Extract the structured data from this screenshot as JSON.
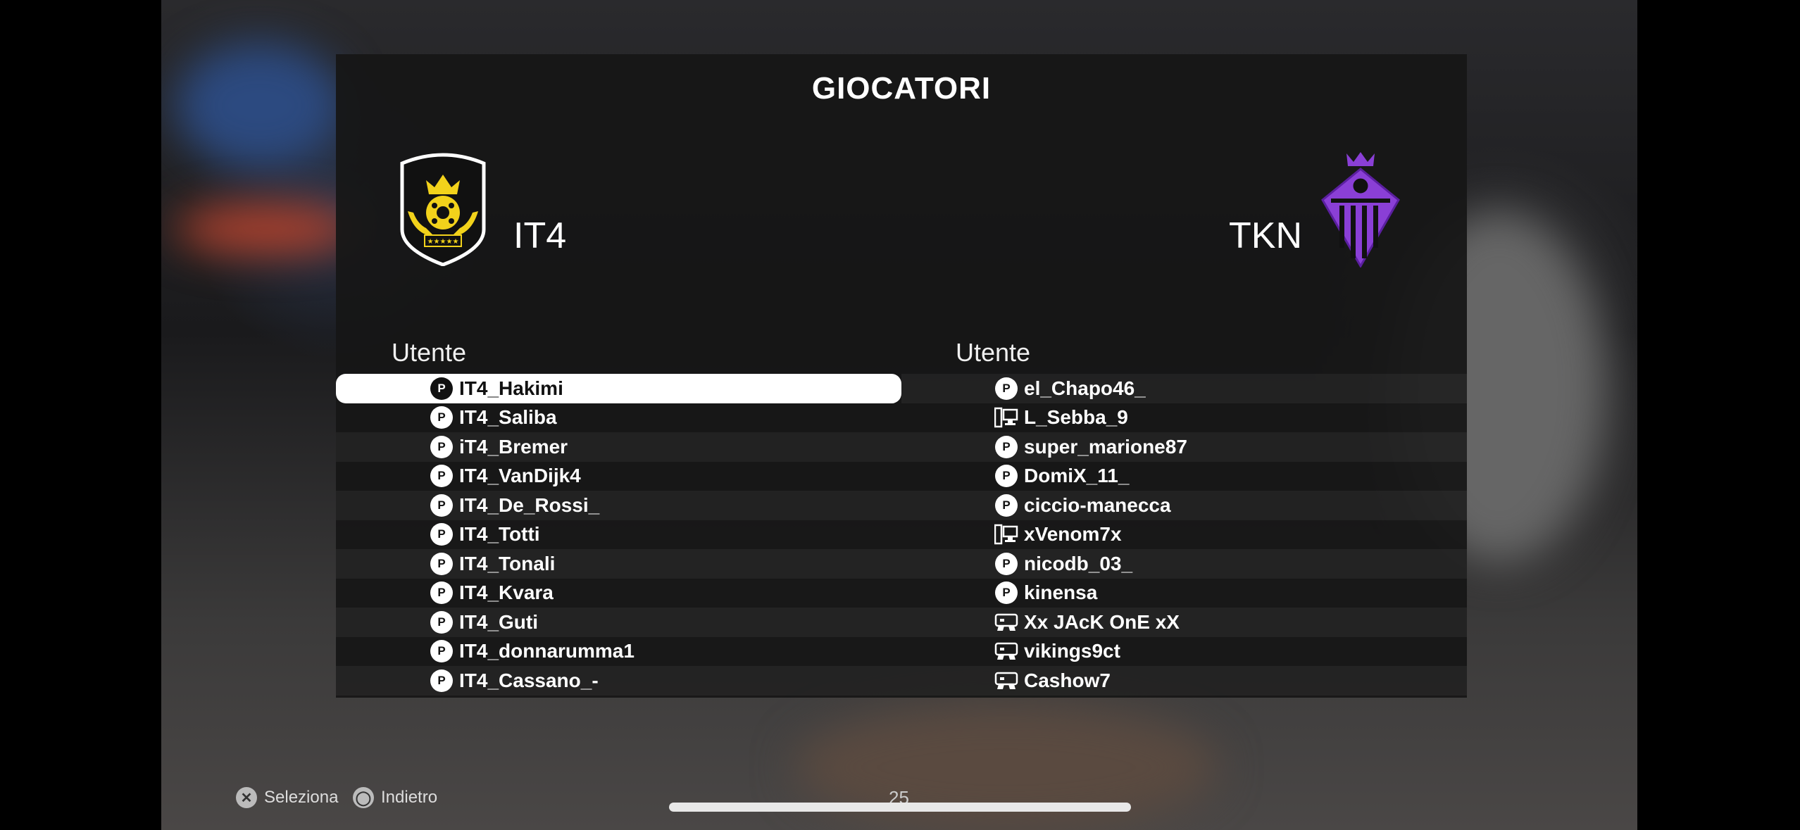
{
  "title": "GIOCATORI",
  "home_team": {
    "name": "IT4"
  },
  "away_team": {
    "name": "TKN"
  },
  "column_header": "Utente",
  "home_players": [
    {
      "name": "IT4_Hakimi",
      "platform": "playstation-icon",
      "selected": true
    },
    {
      "name": "IT4_Saliba",
      "platform": "playstation-icon"
    },
    {
      "name": "iT4_Bremer",
      "platform": "playstation-icon"
    },
    {
      "name": "IT4_VanDijk4",
      "platform": "playstation-icon"
    },
    {
      "name": "IT4_De_Rossi_",
      "platform": "playstation-icon"
    },
    {
      "name": "IT4_Totti",
      "platform": "playstation-icon"
    },
    {
      "name": "IT4_Tonali",
      "platform": "playstation-icon"
    },
    {
      "name": "IT4_Kvara",
      "platform": "playstation-icon"
    },
    {
      "name": "IT4_Guti",
      "platform": "playstation-icon"
    },
    {
      "name": "IT4_donnarumma1",
      "platform": "playstation-icon"
    },
    {
      "name": "IT4_Cassano_-",
      "platform": "playstation-icon"
    }
  ],
  "away_players": [
    {
      "name": "el_Chapo46_",
      "platform": "playstation-icon"
    },
    {
      "name": "L_Sebba_9",
      "platform": "pc-icon"
    },
    {
      "name": "super_marione87",
      "platform": "playstation-icon"
    },
    {
      "name": "DomiX_11_",
      "platform": "playstation-icon"
    },
    {
      "name": "ciccio-manecca",
      "platform": "playstation-icon"
    },
    {
      "name": "xVenom7x",
      "platform": "pc-icon"
    },
    {
      "name": "nicodb_03_",
      "platform": "playstation-icon"
    },
    {
      "name": "kinensa",
      "platform": "playstation-icon"
    },
    {
      "name": "Xx JAcK OnE xX",
      "platform": "xbox-icon"
    },
    {
      "name": "vikings9ct",
      "platform": "xbox-icon"
    },
    {
      "name": "Cashow7",
      "platform": "xbox-icon"
    }
  ],
  "footer": {
    "select_label": "Seleziona",
    "back_label": "Indietro",
    "page": "25"
  },
  "colors": {
    "home_crest": "#f2d21b",
    "away_crest": "#8a3fd6",
    "selected_row": "#ffffff"
  }
}
